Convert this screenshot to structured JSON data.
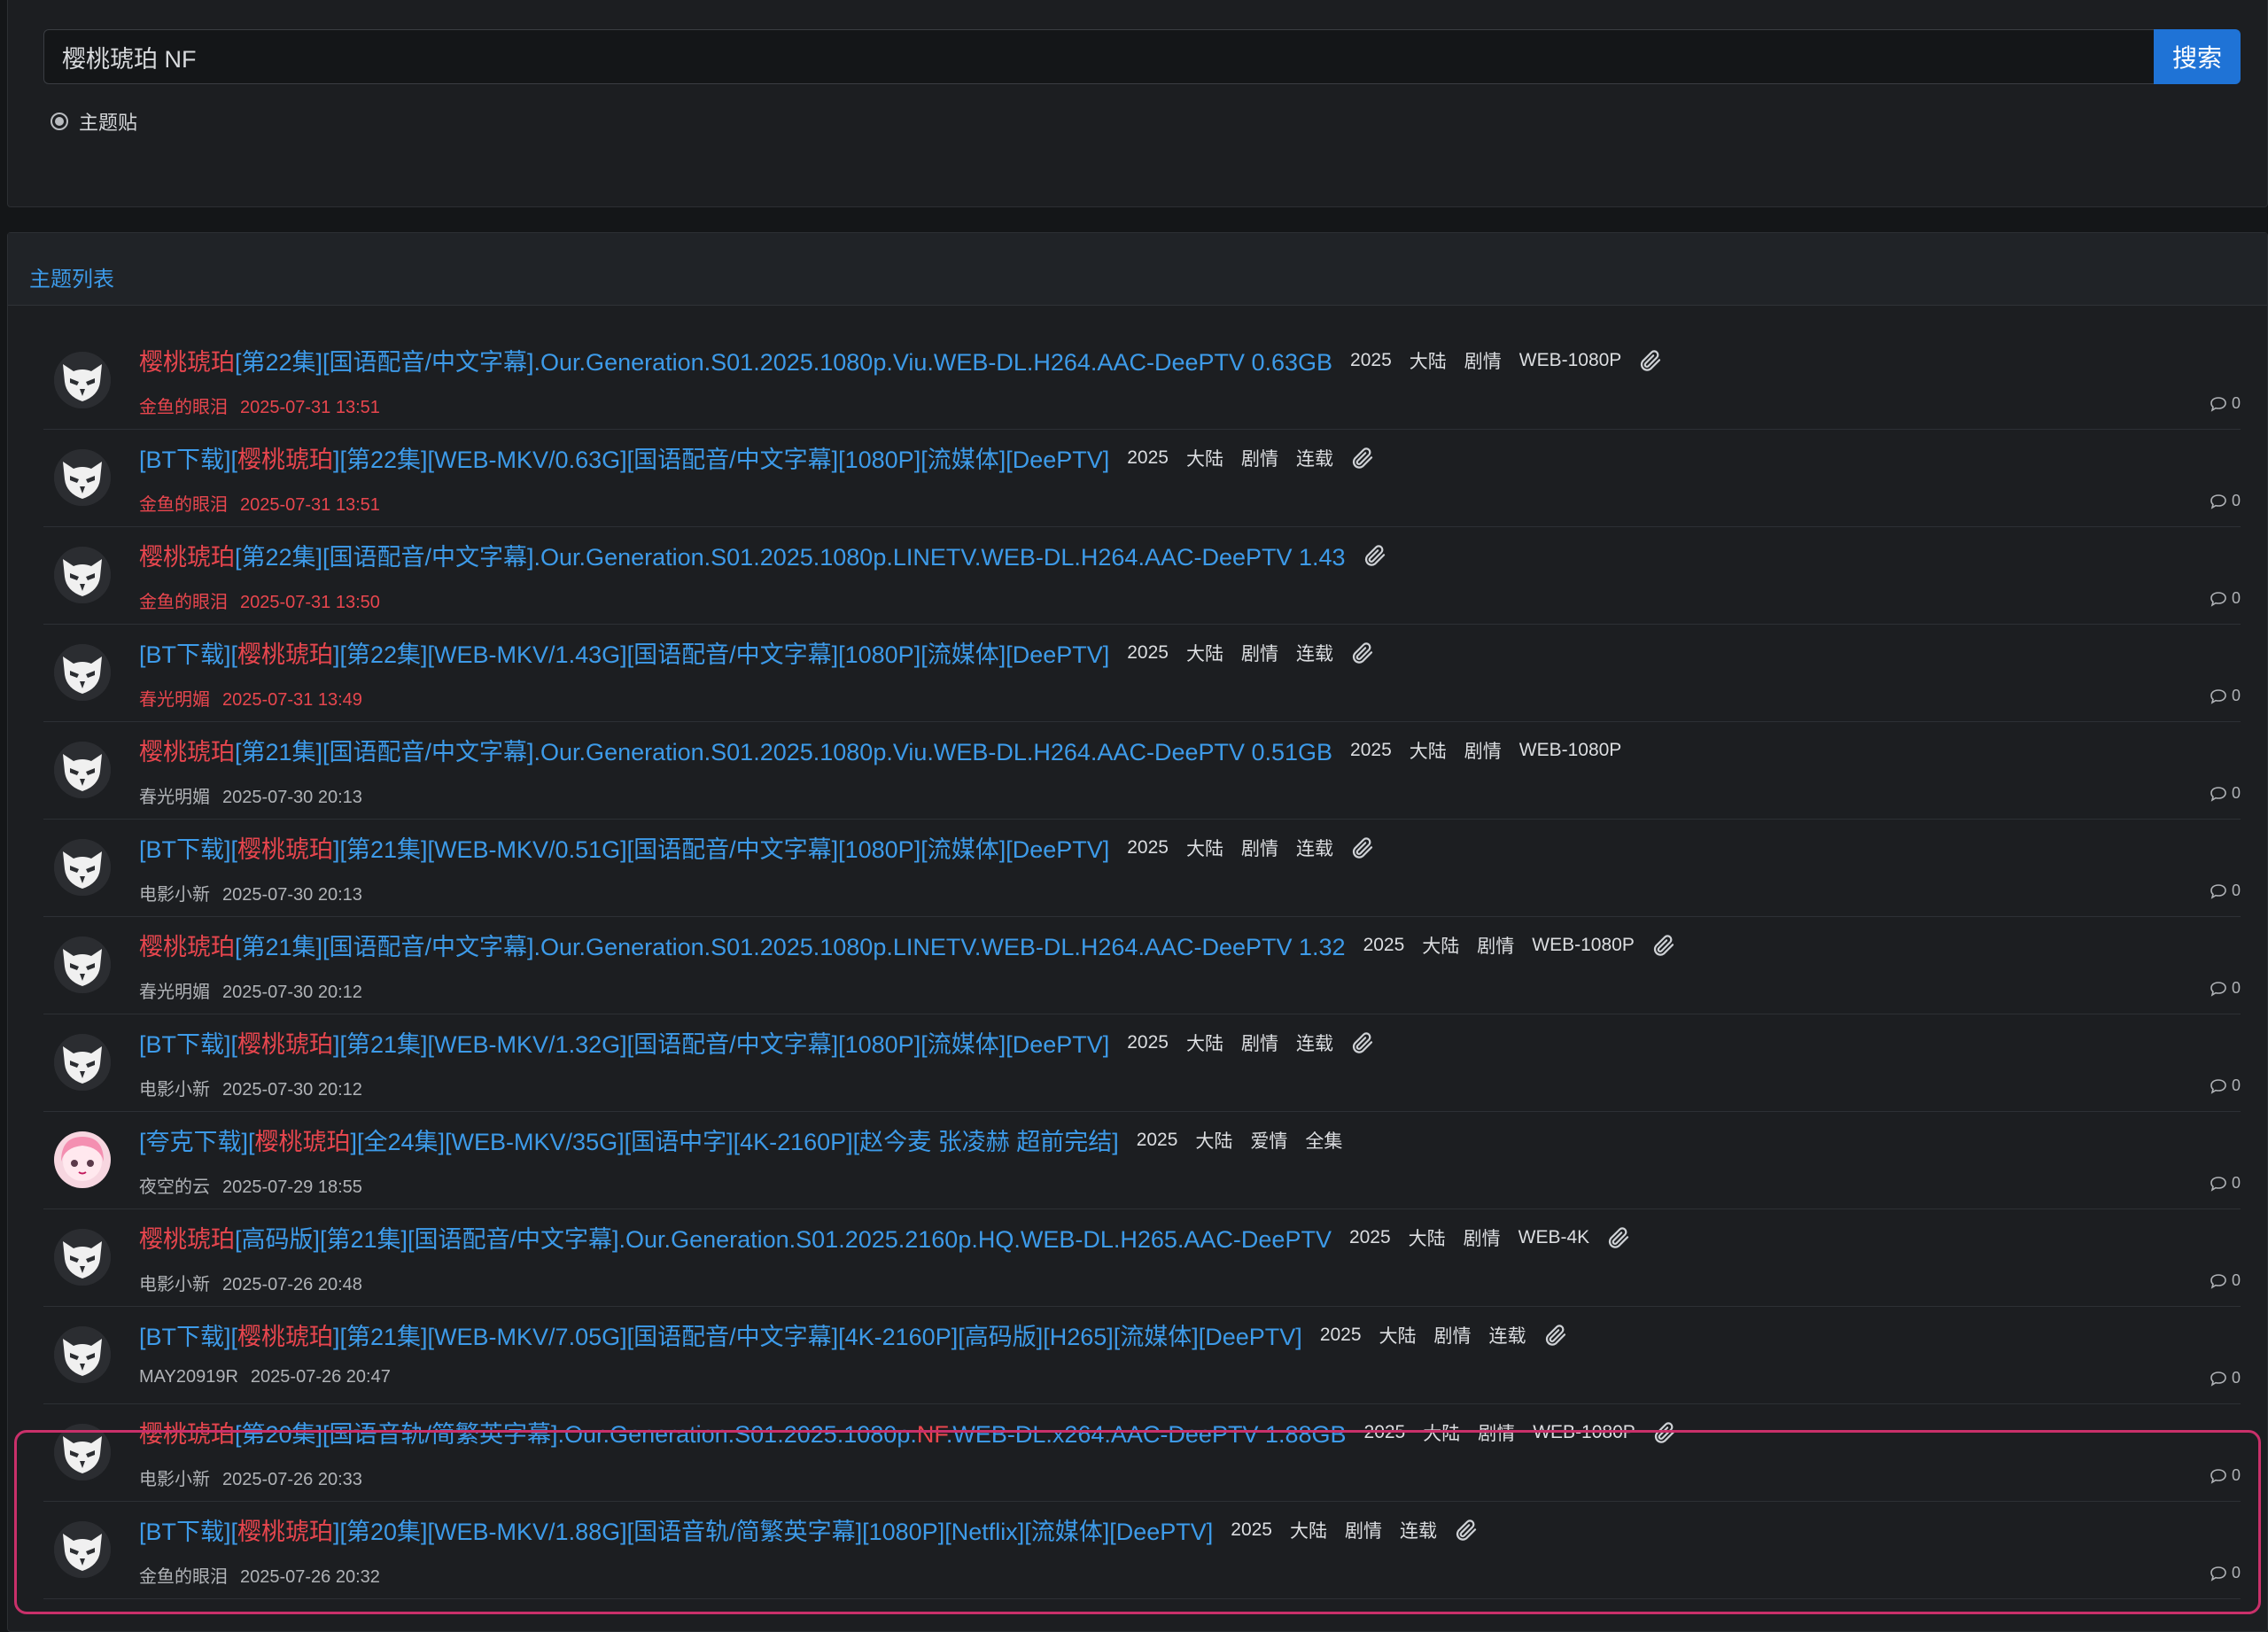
{
  "search": {
    "query": "樱桃琥珀 NF",
    "button_label": "搜索",
    "scope_option": "主题贴"
  },
  "list": {
    "header": "主题列表",
    "rows": [
      {
        "avatar": "mask",
        "title": [
          {
            "t": "樱桃琥珀",
            "hl": true
          },
          {
            "t": "[第22集][国语配音/中文字幕].Our.Generation.S01.2025.1080p.Viu.WEB-DL.H264.AAC-DeePTV 0.63GB"
          }
        ],
        "tags": [
          "2025",
          "大陆",
          "剧情",
          "WEB-1080P"
        ],
        "attachment": true,
        "author": "金鱼的眼泪",
        "time": "2025-07-31 13:51",
        "red_meta": true,
        "replies": "0"
      },
      {
        "avatar": "mask",
        "title": [
          {
            "t": "[BT下载]["
          },
          {
            "t": "樱桃琥珀",
            "hl": true
          },
          {
            "t": "][第22集][WEB-MKV/0.63G][国语配音/中文字幕][1080P][流媒体][DeePTV]"
          }
        ],
        "tags": [
          "2025",
          "大陆",
          "剧情",
          "连载"
        ],
        "attachment": true,
        "author": "金鱼的眼泪",
        "time": "2025-07-31 13:51",
        "red_meta": true,
        "replies": "0"
      },
      {
        "avatar": "mask",
        "title": [
          {
            "t": "樱桃琥珀",
            "hl": true
          },
          {
            "t": "[第22集][国语配音/中文字幕].Our.Generation.S01.2025.1080p.LINETV.WEB-DL.H264.AAC-DeePTV 1.43"
          }
        ],
        "tags": [],
        "attachment": true,
        "author": "金鱼的眼泪",
        "time": "2025-07-31 13:50",
        "red_meta": true,
        "replies": "0"
      },
      {
        "avatar": "mask",
        "title": [
          {
            "t": "[BT下载]["
          },
          {
            "t": "樱桃琥珀",
            "hl": true
          },
          {
            "t": "][第22集][WEB-MKV/1.43G][国语配音/中文字幕][1080P][流媒体][DeePTV]"
          }
        ],
        "tags": [
          "2025",
          "大陆",
          "剧情",
          "连载"
        ],
        "attachment": true,
        "author": "春光明媚",
        "time": "2025-07-31 13:49",
        "red_meta": true,
        "replies": "0"
      },
      {
        "avatar": "mask",
        "title": [
          {
            "t": "樱桃琥珀",
            "hl": true
          },
          {
            "t": "[第21集][国语配音/中文字幕].Our.Generation.S01.2025.1080p.Viu.WEB-DL.H264.AAC-DeePTV 0.51GB"
          }
        ],
        "tags": [
          "2025",
          "大陆",
          "剧情",
          "WEB-1080P"
        ],
        "attachment": false,
        "author": "春光明媚",
        "time": "2025-07-30 20:13",
        "red_meta": false,
        "replies": "0"
      },
      {
        "avatar": "mask",
        "title": [
          {
            "t": "[BT下载]["
          },
          {
            "t": "樱桃琥珀",
            "hl": true
          },
          {
            "t": "][第21集][WEB-MKV/0.51G][国语配音/中文字幕][1080P][流媒体][DeePTV]"
          }
        ],
        "tags": [
          "2025",
          "大陆",
          "剧情",
          "连载"
        ],
        "attachment": true,
        "author": "电影小新",
        "time": "2025-07-30 20:13",
        "red_meta": false,
        "replies": "0"
      },
      {
        "avatar": "mask",
        "title": [
          {
            "t": "樱桃琥珀",
            "hl": true
          },
          {
            "t": "[第21集][国语配音/中文字幕].Our.Generation.S01.2025.1080p.LINETV.WEB-DL.H264.AAC-DeePTV 1.32"
          }
        ],
        "tags": [
          "2025",
          "大陆",
          "剧情",
          "WEB-1080P"
        ],
        "attachment": true,
        "author": "春光明媚",
        "time": "2025-07-30 20:12",
        "red_meta": false,
        "replies": "0"
      },
      {
        "avatar": "mask",
        "title": [
          {
            "t": "[BT下载]["
          },
          {
            "t": "樱桃琥珀",
            "hl": true
          },
          {
            "t": "][第21集][WEB-MKV/1.32G][国语配音/中文字幕][1080P][流媒体][DeePTV]"
          }
        ],
        "tags": [
          "2025",
          "大陆",
          "剧情",
          "连载"
        ],
        "attachment": true,
        "author": "电影小新",
        "time": "2025-07-30 20:12",
        "red_meta": false,
        "replies": "0"
      },
      {
        "avatar": "anime",
        "title": [
          {
            "t": "[夸克下载]["
          },
          {
            "t": "樱桃琥珀",
            "hl": true
          },
          {
            "t": "][全24集][WEB-MKV/35G][国语中字][4K-2160P][赵今麦 张凌赫 超前完结]"
          }
        ],
        "tags": [
          "2025",
          "大陆",
          "爱情",
          "全集"
        ],
        "attachment": false,
        "author": "夜空的云",
        "time": "2025-07-29 18:55",
        "red_meta": false,
        "replies": "0"
      },
      {
        "avatar": "mask",
        "title": [
          {
            "t": "樱桃琥珀",
            "hl": true
          },
          {
            "t": "[高码版][第21集][国语配音/中文字幕].Our.Generation.S01.2025.2160p.HQ.WEB-DL.H265.AAC-DeePTV"
          }
        ],
        "tags": [
          "2025",
          "大陆",
          "剧情",
          "WEB-4K"
        ],
        "attachment": true,
        "author": "电影小新",
        "time": "2025-07-26 20:48",
        "red_meta": false,
        "replies": "0"
      },
      {
        "avatar": "mask",
        "title": [
          {
            "t": "[BT下载]["
          },
          {
            "t": "樱桃琥珀",
            "hl": true
          },
          {
            "t": "][第21集][WEB-MKV/7.05G][国语配音/中文字幕][4K-2160P][高码版][H265][流媒体][DeePTV]"
          }
        ],
        "tags": [
          "2025",
          "大陆",
          "剧情",
          "连载"
        ],
        "attachment": true,
        "author": "MAY20919R",
        "time": "2025-07-26 20:47",
        "red_meta": false,
        "replies": "0"
      },
      {
        "avatar": "mask",
        "title": [
          {
            "t": "樱桃琥珀",
            "hl": true
          },
          {
            "t": "[第20集][国语音轨/简繁英字幕].Our.Generation.S01.2025.1080p."
          },
          {
            "t": "NF",
            "hl": true
          },
          {
            "t": ".WEB-DL.x264.AAC-DeePTV 1.88GB"
          }
        ],
        "tags": [
          "2025",
          "大陆",
          "剧情",
          "WEB-1080P"
        ],
        "attachment": true,
        "author": "电影小新",
        "time": "2025-07-26 20:33",
        "red_meta": false,
        "replies": "0"
      },
      {
        "avatar": "mask",
        "title": [
          {
            "t": "[BT下载]["
          },
          {
            "t": "樱桃琥珀",
            "hl": true
          },
          {
            "t": "][第20集][WEB-MKV/1.88G][国语音轨/简繁英字幕][1080P][Netflix][流媒体][DeePTV]"
          }
        ],
        "tags": [
          "2025",
          "大陆",
          "剧情",
          "连载"
        ],
        "attachment": true,
        "author": "金鱼的眼泪",
        "time": "2025-07-26 20:32",
        "red_meta": false,
        "replies": "0"
      }
    ]
  },
  "colors": {
    "background": "#141618",
    "card": "#1c1e21",
    "link": "#3d9be9",
    "highlight": "#e8464e",
    "button": "#1f73d6",
    "annotation_box": "#c9306a"
  },
  "icons": {
    "attachment": "paperclip-icon",
    "replies": "comment-icon",
    "avatar_default": "mask-avatar-icon",
    "avatar_alt": "anime-girl-avatar-icon"
  }
}
